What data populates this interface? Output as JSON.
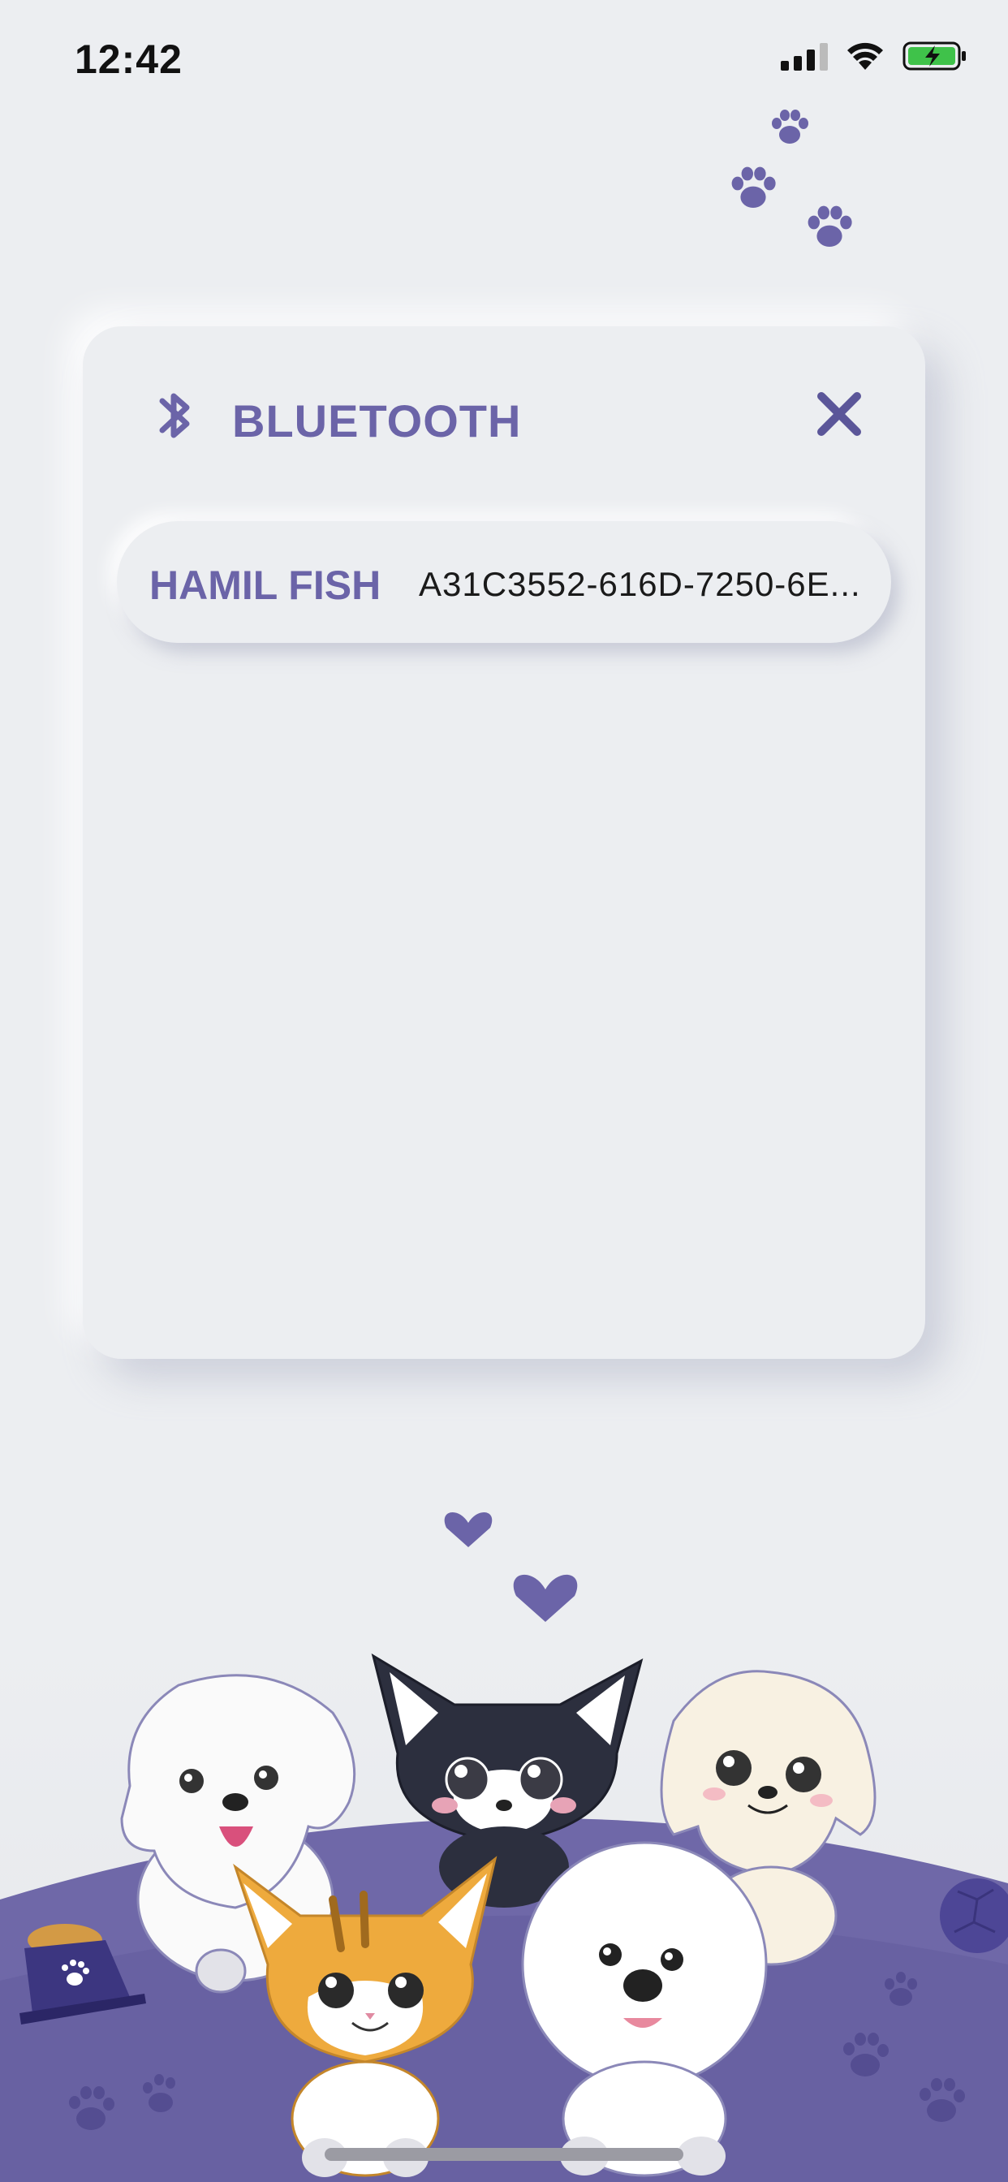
{
  "status_bar": {
    "time": "12:42",
    "icons": [
      "signal-icon",
      "wifi-icon",
      "battery-charging-icon"
    ]
  },
  "card": {
    "icon": "bluetooth-icon",
    "title": "BLUETOOTH",
    "close_icon": "close-icon",
    "devices": [
      {
        "name": "HAMIL FISH",
        "id": "A31C3552-616D-7250-6E..."
      }
    ]
  },
  "colors": {
    "accent": "#6b64a8",
    "background": "#eceef1",
    "ground": "#6f68a8"
  }
}
